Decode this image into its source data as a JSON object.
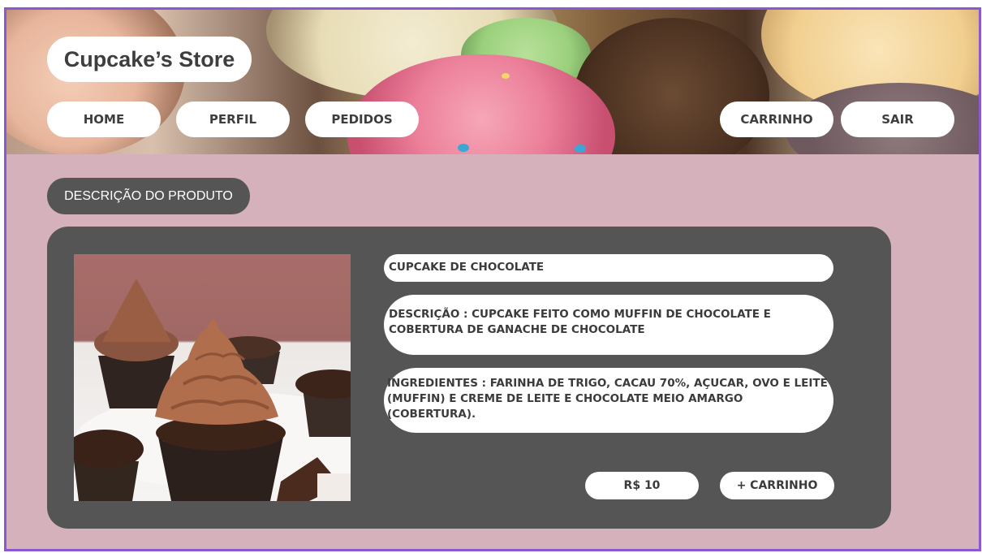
{
  "header": {
    "brand": "Cupcake’s Store",
    "nav": {
      "home": "HOME",
      "perfil": "PERFIL",
      "pedidos": "PEDIDOS",
      "carrinho": "CARRINHO",
      "sair": "SAIR"
    }
  },
  "section": {
    "title": "DESCRIÇÃO DO PRODUTO"
  },
  "product": {
    "name": "CUPCAKE DE CHOCOLATE",
    "description": "DESCRIÇÃO : CUPCAKE FEITO COMO MUFFIN DE CHOCOLATE E COBERTURA DE GANACHE DE CHOCOLATE",
    "ingredients": "INGREDIENTES : FARINHA DE TRIGO, CACAU 70%, AÇUCAR, OVO E LEITE (MUFFIN) E CREME DE LEITE E CHOCOLATE MEIO AMARGO (COBERTURA).",
    "price": "R$ 10",
    "add_to_cart": "+ CARRINHO"
  },
  "colors": {
    "frame_border": "#8a58d2",
    "page_background": "#d4b1bb",
    "card_background": "#555555",
    "pill_background": "#ffffff",
    "text_dark": "#3e3e3e"
  },
  "icons": {
    "hero": "cupcakes-banner-image",
    "product": "chocolate-cupcake-image"
  }
}
